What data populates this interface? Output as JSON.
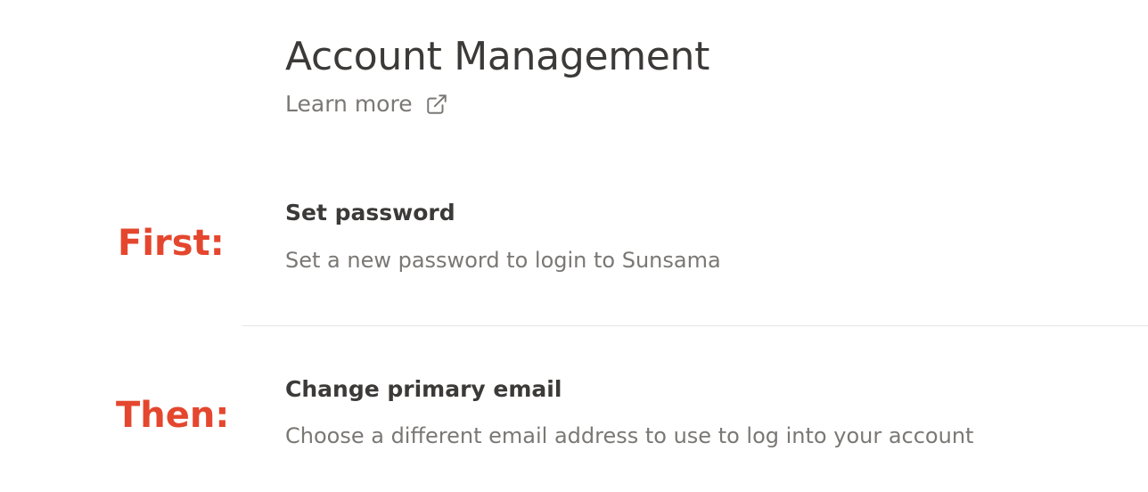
{
  "header": {
    "title": "Account Management",
    "learn_more": "Learn more",
    "learn_more_icon": "external-link-icon"
  },
  "annotations": {
    "first": "First:",
    "then": "Then:",
    "color": "#e4472e"
  },
  "settings": [
    {
      "title": "Set password",
      "description": "Set a new password to login to Sunsama"
    },
    {
      "title": "Change primary email",
      "description": "Choose a different email address to use to log into your account"
    }
  ]
}
